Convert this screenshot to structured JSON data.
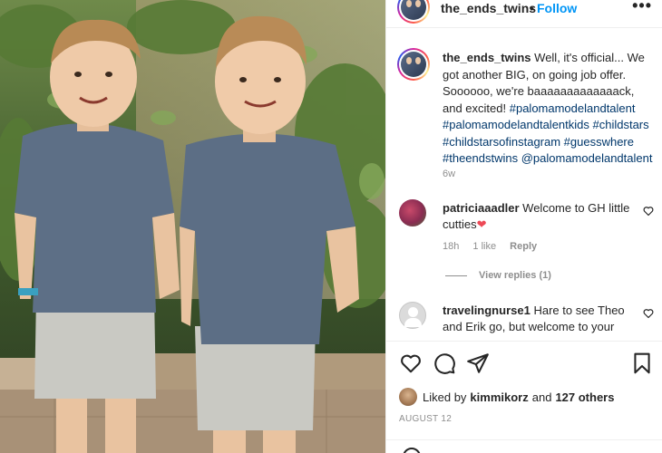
{
  "post": {
    "header": {
      "username": "the_ends_twins",
      "separator": "•",
      "follow_label": "Follow",
      "more_label": "•••"
    },
    "caption": {
      "username": "the_ends_twins",
      "text": "Well, it's official... We got another BIG, on going job offer. Soooooo, we're baaaaaaaaaaaaack, and excited!",
      "tags": "#palomamodelandtalent #palomamodelandtalentkids #childstars #childstarsofinstagram #guesswhere #theendstwins @palomamodelandtalent",
      "time": "6w"
    },
    "comments": [
      {
        "username": "patriciaaadler",
        "text": "Welcome to GH little cutties",
        "emoji": "❤",
        "time": "18h",
        "likes": "1 like",
        "reply_label": "Reply",
        "view_replies": "View replies (1)"
      },
      {
        "username": "travelingnurse1",
        "text": "Hare to see Theo and Erik go, but welcome to your"
      }
    ],
    "likes": {
      "prefix": "Liked by",
      "user": "kimmikorz",
      "and": "and",
      "others": "127 others"
    },
    "date": "AUGUST 12"
  },
  "icons": {
    "like": "heart-outline-icon",
    "comment": "comment-bubble-icon",
    "share": "paper-plane-icon",
    "save": "bookmark-icon",
    "comment_like": "small-heart-icon"
  },
  "colors": {
    "link_blue": "#0095f6",
    "hashtag": "#00376b",
    "muted": "#8e8e8e",
    "text": "#262626",
    "heart": "#ed4956"
  }
}
